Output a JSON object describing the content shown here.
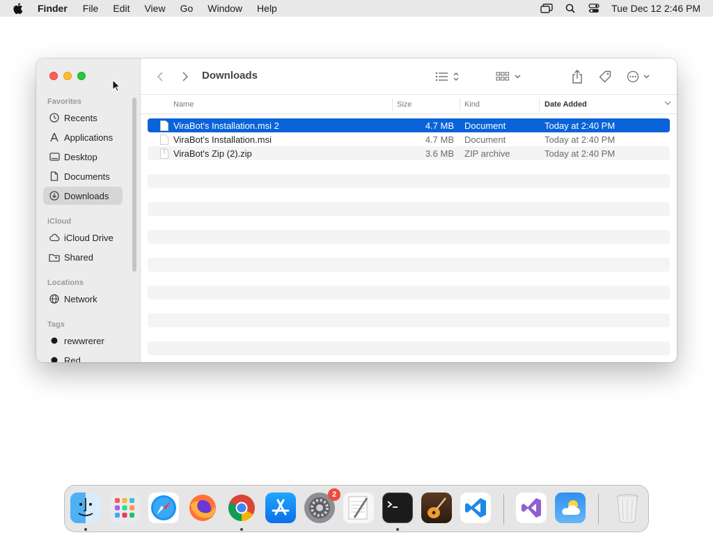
{
  "menubar": {
    "app_name": "Finder",
    "menus": [
      "File",
      "Edit",
      "View",
      "Go",
      "Window",
      "Help"
    ],
    "clock": "Tue Dec 12  2:46 PM"
  },
  "window": {
    "title": "Downloads",
    "sidebar": {
      "favorites_header": "Favorites",
      "favorites": [
        {
          "label": "Recents",
          "icon": "clock-icon"
        },
        {
          "label": "Applications",
          "icon": "applications-icon"
        },
        {
          "label": "Desktop",
          "icon": "desktop-icon"
        },
        {
          "label": "Documents",
          "icon": "document-icon"
        },
        {
          "label": "Downloads",
          "icon": "download-icon",
          "selected": true
        }
      ],
      "icloud_header": "iCloud",
      "icloud": [
        {
          "label": "iCloud Drive",
          "icon": "cloud-icon"
        },
        {
          "label": "Shared",
          "icon": "shared-folder-icon"
        }
      ],
      "locations_header": "Locations",
      "locations": [
        {
          "label": "Network",
          "icon": "globe-icon"
        }
      ],
      "tags_header": "Tags",
      "tags": [
        {
          "label": "rewwrerer",
          "color": "#1a1a1a"
        },
        {
          "label": "Red",
          "color": "#1a1a1a"
        }
      ]
    },
    "columns": {
      "name": "Name",
      "size": "Size",
      "kind": "Kind",
      "date_added": "Date Added"
    },
    "files": [
      {
        "name": "ViraBot's Installation.msi 2",
        "size": "4.7 MB",
        "kind": "Document",
        "date": "Today at 2:40 PM",
        "selected": true
      },
      {
        "name": "ViraBot's Installation.msi",
        "size": "4.7 MB",
        "kind": "Document",
        "date": "Today at 2:40 PM"
      },
      {
        "name": "ViraBot's Zip (2).zip",
        "size": "3.6 MB",
        "kind": "ZIP archive",
        "date": "Today at 2:40 PM"
      }
    ]
  },
  "dock": {
    "apps": [
      "Finder",
      "Launchpad",
      "Safari",
      "Firefox",
      "Chrome",
      "App Store",
      "System Settings",
      "TextEdit",
      "Terminal",
      "GarageBand",
      "Visual Studio Code",
      "Visual Studio",
      "Weather",
      "Trash"
    ],
    "settings_badge": "2"
  },
  "colors": {
    "selection": "#0a63d8",
    "sidebar_bg": "#ececec",
    "menubar_bg": "#e8e8e8"
  }
}
